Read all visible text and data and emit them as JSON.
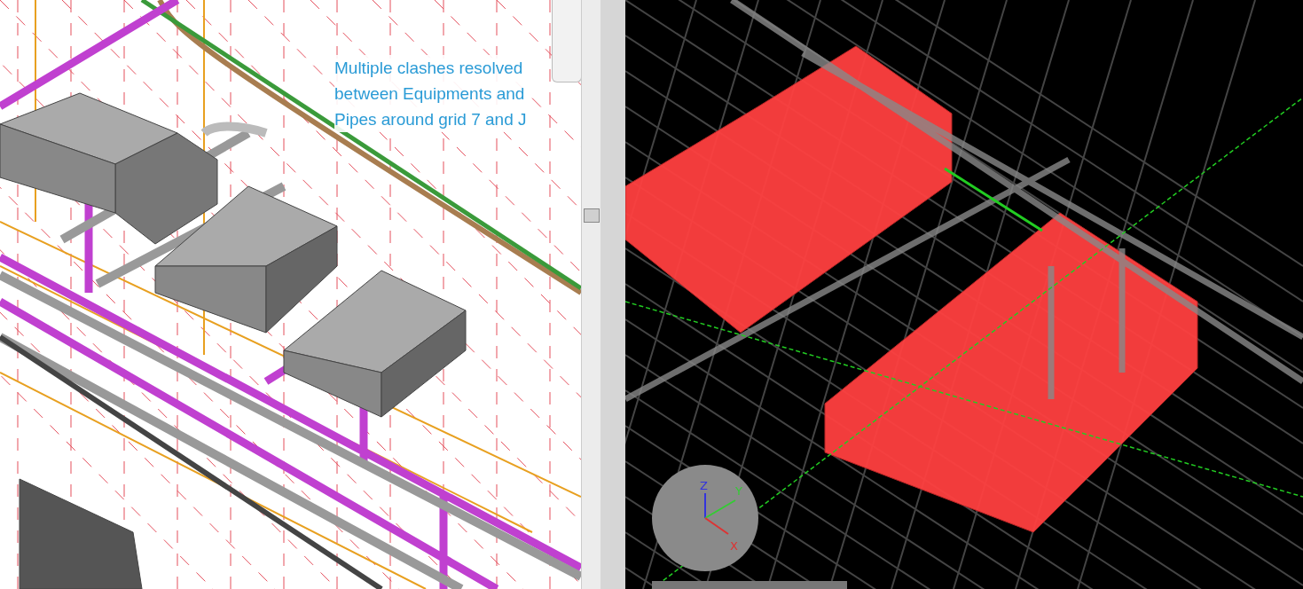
{
  "left_view": {
    "note_lines": [
      "Multiple clashes resolved",
      "between Equipments and",
      "Pipes around grid 7 and J"
    ]
  },
  "right_view": {
    "axis_labels": [
      "Z",
      "Y",
      "X"
    ]
  }
}
